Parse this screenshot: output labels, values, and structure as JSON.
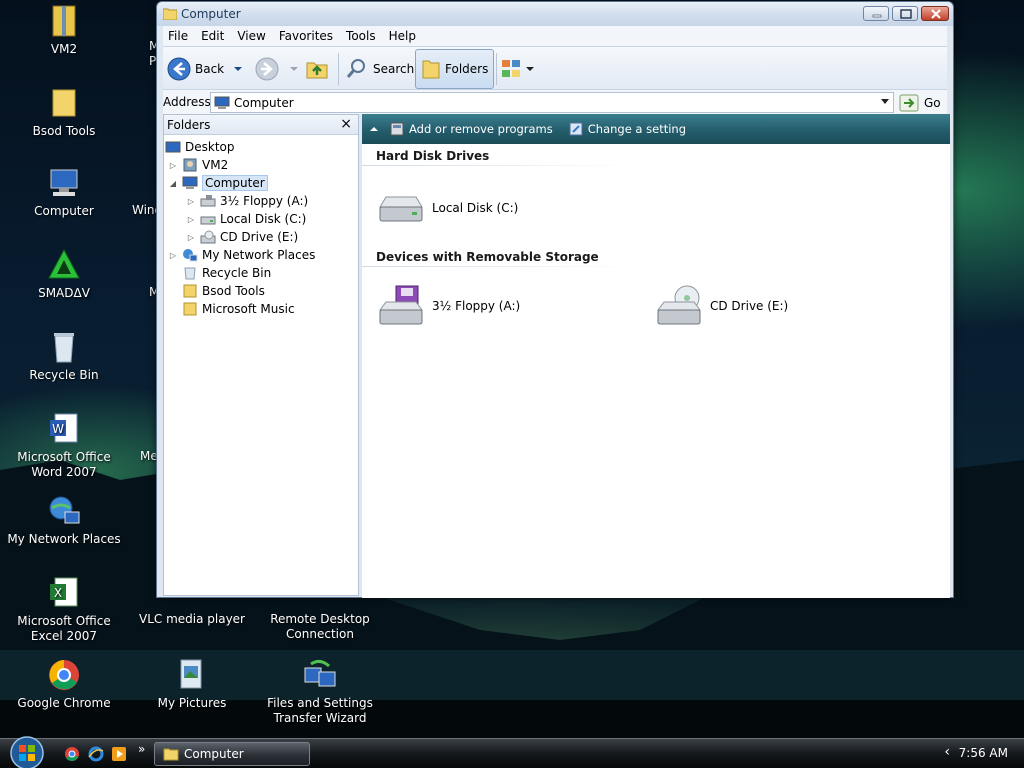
{
  "desktop": {
    "icons": [
      {
        "label": "VM2"
      },
      {
        "label": "Bsod Tools"
      },
      {
        "label": "Computer"
      },
      {
        "label": "SMADΔV"
      },
      {
        "label": "Recycle Bin"
      },
      {
        "label": "Microsoft Office Word 2007"
      },
      {
        "label": "My Network Places"
      },
      {
        "label": "Microsoft Office Excel 2007"
      },
      {
        "label": "Google Chrome"
      },
      {
        "label": "VLC media player"
      },
      {
        "label": "Remote Desktop Connection"
      },
      {
        "label": "My Pictures"
      },
      {
        "label": "Files and Settings Transfer Wizard"
      }
    ],
    "partial_labels": [
      "M",
      "P",
      "Wind",
      "M",
      "Me"
    ]
  },
  "window": {
    "title": "Computer",
    "menu": [
      "File",
      "Edit",
      "View",
      "Favorites",
      "Tools",
      "Help"
    ],
    "toolbar": {
      "back_label": "Back",
      "search_label": "Search",
      "folders_label": "Folders"
    },
    "address": {
      "label": "Address",
      "value": "Computer",
      "go_label": "Go"
    },
    "folders_pane": {
      "title": "Folders",
      "close": "×",
      "tree": [
        {
          "label": "Desktop"
        },
        {
          "label": "VM2"
        },
        {
          "label": "Computer"
        },
        {
          "label": "3½ Floppy (A:)"
        },
        {
          "label": "Local Disk (C:)"
        },
        {
          "label": "CD Drive (E:)"
        },
        {
          "label": "My Network Places"
        },
        {
          "label": "Recycle Bin"
        },
        {
          "label": "Bsod Tools"
        },
        {
          "label": "Microsoft Music"
        }
      ]
    },
    "tasks": [
      {
        "label": "Add or remove programs"
      },
      {
        "label": "Change a setting"
      }
    ],
    "groups": [
      {
        "title": "Hard Disk Drives",
        "items": [
          {
            "label": "Local Disk (C:)"
          }
        ]
      },
      {
        "title": "Devices with Removable Storage",
        "items": [
          {
            "label": "3½ Floppy (A:)"
          },
          {
            "label": "CD Drive (E:)"
          }
        ]
      }
    ]
  },
  "taskbar": {
    "active_task": "Computer",
    "chevron": "»",
    "tray_arrow": "‹",
    "clock": "7:56 AM"
  }
}
